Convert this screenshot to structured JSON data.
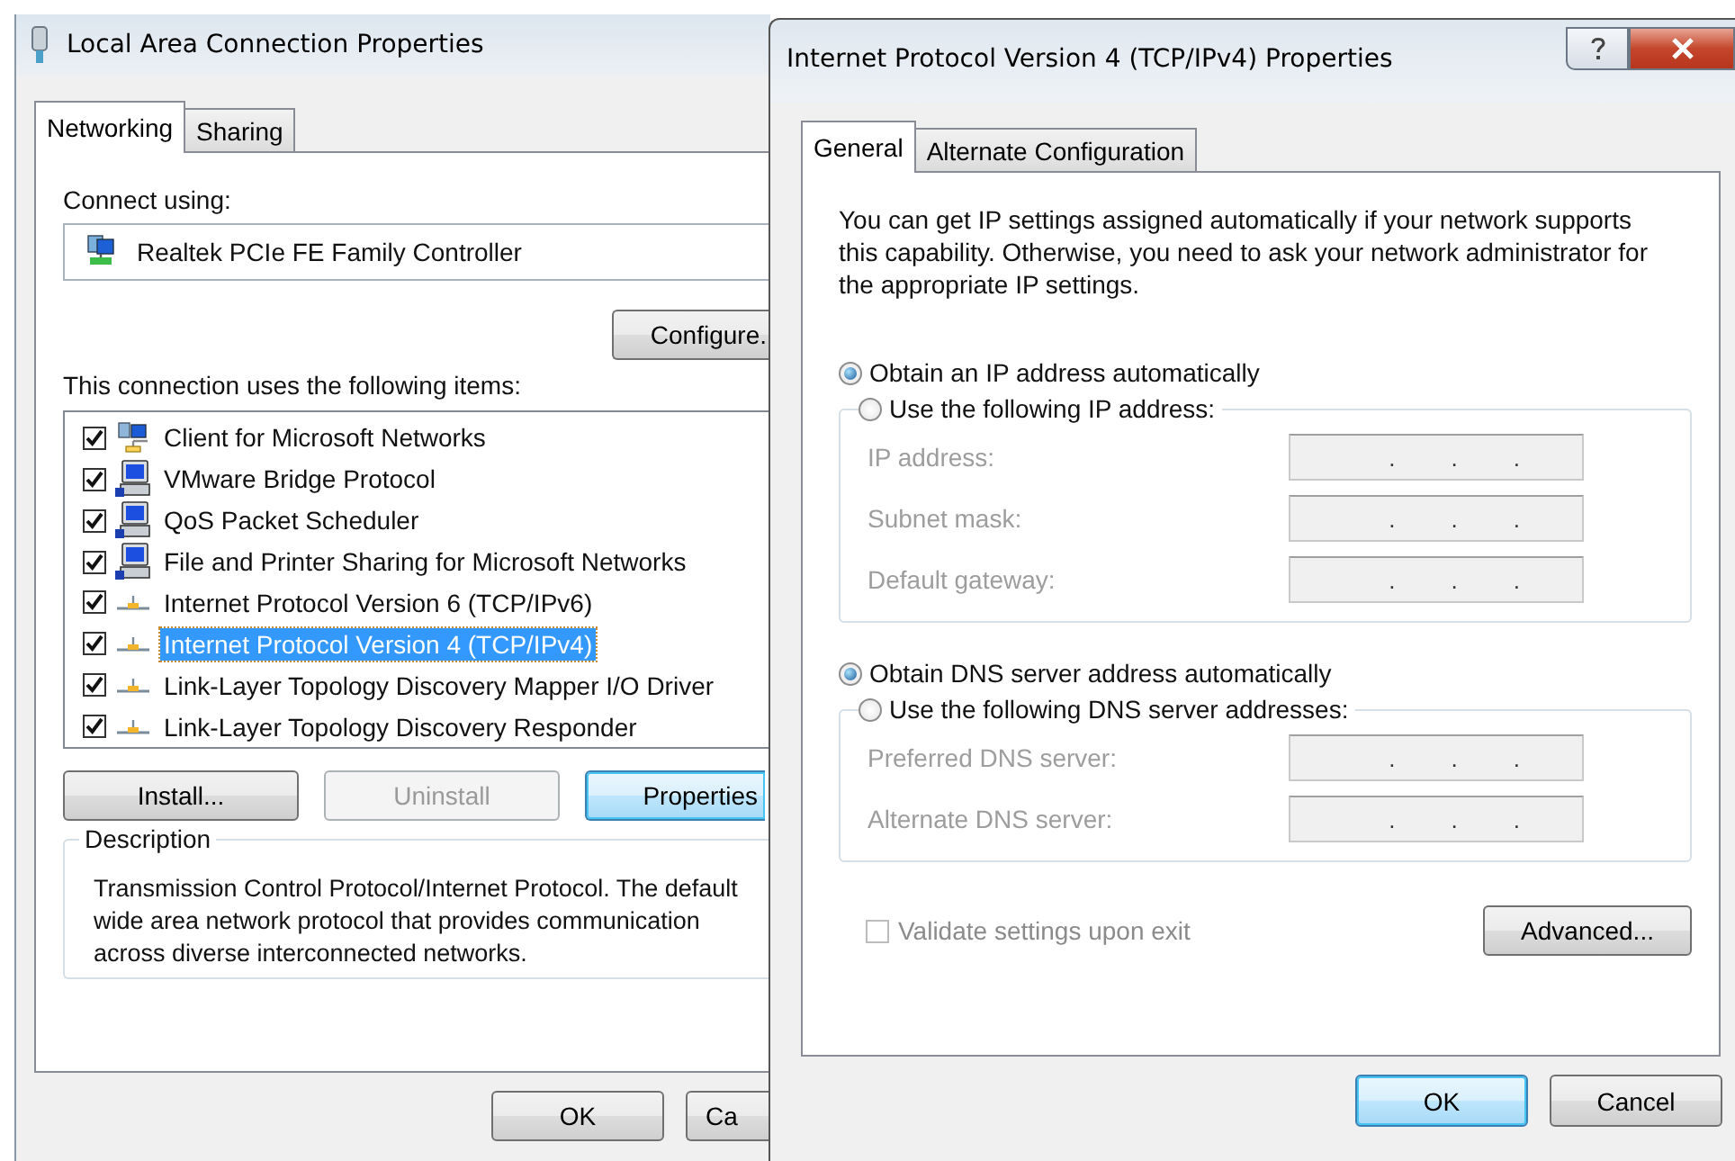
{
  "windows": [
    {
      "kind": "adapter",
      "title": "Local Area Connection Properties",
      "tabs": [
        {
          "label": "Networking",
          "selected": true
        },
        {
          "label": "Sharing",
          "selected": false
        }
      ],
      "connect_label": "Connect using:",
      "adapter": "Realtek PCIe FE Family Controller",
      "configure_button": "Configure.",
      "items_label": "This connection uses the following items:",
      "items": [
        {
          "label": "Client for Microsoft Networks",
          "checked": true,
          "selected": false,
          "kind": "client"
        },
        {
          "label": "VMware Bridge Protocol",
          "checked": true,
          "selected": false,
          "kind": "service"
        },
        {
          "label": "QoS Packet Scheduler",
          "checked": true,
          "selected": false,
          "kind": "service"
        },
        {
          "label": "File and Printer Sharing for Microsoft Networks",
          "checked": true,
          "selected": false,
          "kind": "service"
        },
        {
          "label": "Internet Protocol Version 6 (TCP/IPv6)",
          "checked": true,
          "selected": false,
          "kind": "protocol"
        },
        {
          "label": "Internet Protocol Version 4 (TCP/IPv4)",
          "checked": true,
          "selected": true,
          "kind": "protocol"
        },
        {
          "label": "Link-Layer Topology Discovery Mapper I/O Driver",
          "checked": true,
          "selected": false,
          "kind": "protocol"
        },
        {
          "label": "Link-Layer Topology Discovery Responder",
          "checked": true,
          "selected": false,
          "kind": "protocol"
        }
      ],
      "item_buttons": [
        {
          "label": "Install...",
          "disabled": false,
          "default": false
        },
        {
          "label": "Uninstall",
          "disabled": true,
          "default": false
        },
        {
          "label": "Properties",
          "disabled": false,
          "default": true
        }
      ],
      "description": {
        "title": "Description",
        "text": "Transmission Control Protocol/Internet Protocol. The default\nwide area network protocol that provides communication\nacross diverse interconnected networks."
      },
      "buttons": [
        {
          "label": "OK",
          "default": false
        },
        {
          "label": "Ca",
          "default": false
        }
      ]
    },
    {
      "kind": "ipv4",
      "title": "Internet Protocol Version 4 (TCP/IPv4) Properties",
      "tabs": [
        {
          "label": "General",
          "selected": true
        },
        {
          "label": "Alternate Configuration",
          "selected": false
        }
      ],
      "intro": "You can get IP settings assigned automatically if your network supports this capability. Otherwise, you need to ask your network administrator for the appropriate IP settings.",
      "groups": [
        {
          "options": [
            {
              "label": "Obtain an IP address automatically",
              "selected": true
            },
            {
              "label": "Use the following IP address:",
              "selected": false
            }
          ],
          "fields": [
            {
              "label": "IP address:",
              "dots": [
                ".",
                ".",
                "."
              ]
            },
            {
              "label": "Subnet mask:",
              "dots": [
                ".",
                ".",
                "."
              ]
            },
            {
              "label": "Default gateway:",
              "dots": [
                ".",
                ".",
                "."
              ]
            }
          ]
        },
        {
          "options": [
            {
              "label": "Obtain DNS server address automatically",
              "selected": true
            },
            {
              "label": "Use the following DNS server addresses:",
              "selected": false
            }
          ],
          "fields": [
            {
              "label": "Preferred DNS server:",
              "dots": [
                ".",
                ".",
                "."
              ]
            },
            {
              "label": "Alternate DNS server:",
              "dots": [
                ".",
                ".",
                "."
              ]
            }
          ]
        }
      ],
      "validate": {
        "label": "Validate settings upon exit",
        "checked": false,
        "disabled": true
      },
      "advanced_button": "Advanced...",
      "buttons": [
        {
          "label": "OK",
          "default": true
        },
        {
          "label": "Cancel",
          "default": false
        }
      ]
    }
  ]
}
